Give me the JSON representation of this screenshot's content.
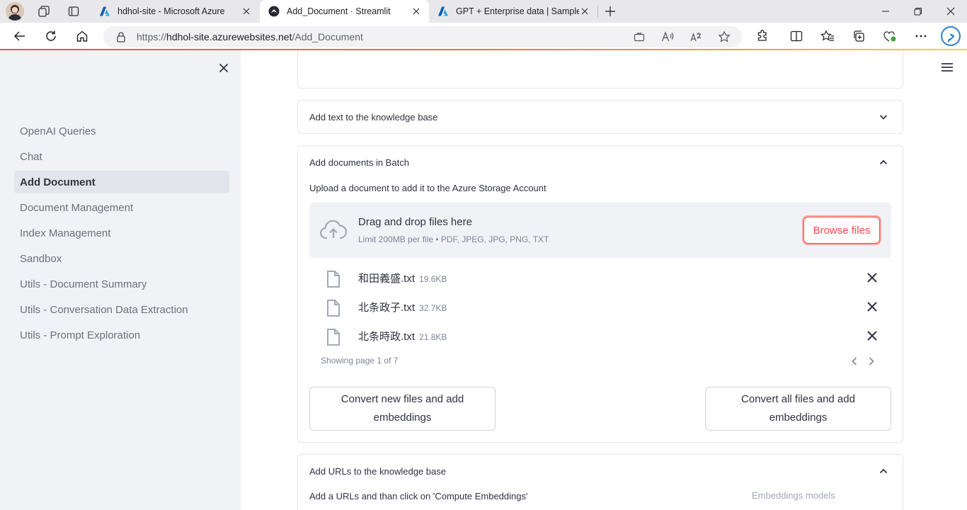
{
  "browser": {
    "tabs": [
      {
        "label": "hdhol-site - Microsoft Azure",
        "active": false
      },
      {
        "label": "Add_Document · Streamlit",
        "active": true
      },
      {
        "label": "GPT + Enterprise data | Sample",
        "active": false
      }
    ],
    "url": {
      "scheme": "https://",
      "host": "hdhol-site.azurewebsites.net",
      "path": "/Add_Document"
    },
    "accent_colors": {
      "azure": "#0078d4",
      "streamlit": "#ff4b4b"
    }
  },
  "sidebar": {
    "items": [
      {
        "label": "OpenAI Queries",
        "active": false
      },
      {
        "label": "Chat",
        "active": false
      },
      {
        "label": "Add Document",
        "active": true
      },
      {
        "label": "Document Management",
        "active": false
      },
      {
        "label": "Index Management",
        "active": false
      },
      {
        "label": "Sandbox",
        "active": false
      },
      {
        "label": "Utils - Document Summary",
        "active": false
      },
      {
        "label": "Utils - Conversation Data Extraction",
        "active": false
      },
      {
        "label": "Utils - Prompt Exploration",
        "active": false
      }
    ]
  },
  "main": {
    "expander_text": {
      "title": "Add text to the knowledge base",
      "expanded": false
    },
    "expander_batch": {
      "title": "Add documents in Batch",
      "expanded": true,
      "help": "Upload a document to add it to the Azure Storage Account",
      "dropzone": {
        "title": "Drag and drop files here",
        "subtitle": "Limit 200MB per file • PDF, JPEG, JPG, PNG, TXT",
        "browse_label": "Browse files"
      },
      "files": [
        {
          "name": "和田義盛.txt",
          "size": "19.6KB"
        },
        {
          "name": "北条政子.txt",
          "size": "32.7KB"
        },
        {
          "name": "北条時政.txt",
          "size": "21.8KB"
        }
      ],
      "pager": "Showing page 1 of 7",
      "convert_new_label": "Convert new files and add embeddings",
      "convert_all_label": "Convert all files and add embeddings"
    },
    "expander_urls": {
      "title": "Add URLs to the knowledge base",
      "expanded": true,
      "help": "Add a URLs and than click on 'Compute Embeddings'",
      "side_label": "Embeddings models"
    }
  }
}
